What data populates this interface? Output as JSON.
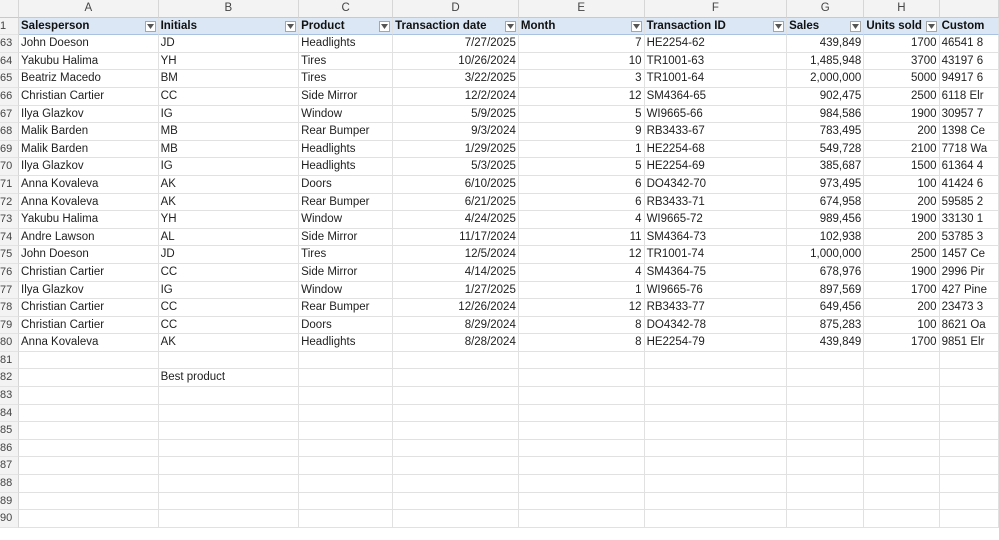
{
  "column_letters": [
    "A",
    "B",
    "C",
    "D",
    "E",
    "F",
    "G",
    "H",
    ""
  ],
  "header_row_number": "1",
  "headers": [
    "Salesperson",
    "Initials",
    "Product",
    "Transaction date",
    "Month",
    "Transaction ID",
    "Sales",
    "Units sold",
    "Custom"
  ],
  "rows": [
    {
      "n": "63",
      "cells": [
        "John Doeson",
        "JD",
        "Headlights",
        "7/27/2025",
        "7",
        "HE2254-62",
        "439,849",
        "1700",
        "46541 8"
      ]
    },
    {
      "n": "64",
      "cells": [
        "Yakubu Halima",
        "YH",
        "Tires",
        "10/26/2024",
        "10",
        "TR1001-63",
        "1,485,948",
        "3700",
        "43197 6"
      ]
    },
    {
      "n": "65",
      "cells": [
        "Beatriz Macedo",
        "BM",
        "Tires",
        "3/22/2025",
        "3",
        "TR1001-64",
        "2,000,000",
        "5000",
        "94917 6"
      ]
    },
    {
      "n": "66",
      "cells": [
        "Christian Cartier",
        "CC",
        "Side Mirror",
        "12/2/2024",
        "12",
        "SM4364-65",
        "902,475",
        "2500",
        "6118 Elr"
      ]
    },
    {
      "n": "67",
      "cells": [
        "Ilya Glazkov",
        "IG",
        "Window",
        "5/9/2025",
        "5",
        "WI9665-66",
        "984,586",
        "1900",
        "30957 7"
      ]
    },
    {
      "n": "68",
      "cells": [
        "Malik Barden",
        "MB",
        "Rear Bumper",
        "9/3/2024",
        "9",
        "RB3433-67",
        "783,495",
        "200",
        "1398 Ce"
      ]
    },
    {
      "n": "69",
      "cells": [
        "Malik Barden",
        "MB",
        "Headlights",
        "1/29/2025",
        "1",
        "HE2254-68",
        "549,728",
        "2100",
        "7718 Wa"
      ]
    },
    {
      "n": "70",
      "cells": [
        "Ilya Glazkov",
        "IG",
        "Headlights",
        "5/3/2025",
        "5",
        "HE2254-69",
        "385,687",
        "1500",
        "61364 4"
      ]
    },
    {
      "n": "71",
      "cells": [
        "Anna Kovaleva",
        "AK",
        "Doors",
        "6/10/2025",
        "6",
        "DO4342-70",
        "973,495",
        "100",
        "41424 6"
      ]
    },
    {
      "n": "72",
      "cells": [
        "Anna Kovaleva",
        "AK",
        "Rear Bumper",
        "6/21/2025",
        "6",
        "RB3433-71",
        "674,958",
        "200",
        "59585 2"
      ]
    },
    {
      "n": "73",
      "cells": [
        "Yakubu Halima",
        "YH",
        "Window",
        "4/24/2025",
        "4",
        "WI9665-72",
        "989,456",
        "1900",
        "33130 1"
      ]
    },
    {
      "n": "74",
      "cells": [
        "Andre Lawson",
        "AL",
        "Side Mirror",
        "11/17/2024",
        "11",
        "SM4364-73",
        "102,938",
        "200",
        "53785 3"
      ]
    },
    {
      "n": "75",
      "cells": [
        "John Doeson",
        "JD",
        "Tires",
        "12/5/2024",
        "12",
        "TR1001-74",
        "1,000,000",
        "2500",
        "1457 Ce"
      ]
    },
    {
      "n": "76",
      "cells": [
        "Christian Cartier",
        "CC",
        "Side Mirror",
        "4/14/2025",
        "4",
        "SM4364-75",
        "678,976",
        "1900",
        "2996 Pir"
      ]
    },
    {
      "n": "77",
      "cells": [
        "Ilya Glazkov",
        "IG",
        "Window",
        "1/27/2025",
        "1",
        "WI9665-76",
        "897,569",
        "1700",
        "427 Pine"
      ]
    },
    {
      "n": "78",
      "cells": [
        "Christian Cartier",
        "CC",
        "Rear Bumper",
        "12/26/2024",
        "12",
        "RB3433-77",
        "649,456",
        "200",
        "23473 3"
      ]
    },
    {
      "n": "79",
      "cells": [
        "Christian Cartier",
        "CC",
        "Doors",
        "8/29/2024",
        "8",
        "DO4342-78",
        "875,283",
        "100",
        "8621 Oa"
      ]
    },
    {
      "n": "80",
      "cells": [
        "Anna Kovaleva",
        "AK",
        "Headlights",
        "8/28/2024",
        "8",
        "HE2254-79",
        "439,849",
        "1700",
        "9851 Elr"
      ]
    },
    {
      "n": "81",
      "cells": [
        "",
        "",
        "",
        "",
        "",
        "",
        "",
        "",
        ""
      ]
    },
    {
      "n": "82",
      "cells": [
        "",
        "Best product",
        "",
        "",
        "",
        "",
        "",
        "",
        ""
      ]
    },
    {
      "n": "83",
      "cells": [
        "",
        "",
        "",
        "",
        "",
        "",
        "",
        "",
        ""
      ]
    },
    {
      "n": "84",
      "cells": [
        "",
        "",
        "",
        "",
        "",
        "",
        "",
        "",
        ""
      ]
    },
    {
      "n": "85",
      "cells": [
        "",
        "",
        "",
        "",
        "",
        "",
        "",
        "",
        ""
      ]
    },
    {
      "n": "86",
      "cells": [
        "",
        "",
        "",
        "",
        "",
        "",
        "",
        "",
        ""
      ]
    },
    {
      "n": "87",
      "cells": [
        "",
        "",
        "",
        "",
        "",
        "",
        "",
        "",
        ""
      ]
    },
    {
      "n": "88",
      "cells": [
        "",
        "",
        "",
        "",
        "",
        "",
        "",
        "",
        ""
      ]
    },
    {
      "n": "89",
      "cells": [
        "",
        "",
        "",
        "",
        "",
        "",
        "",
        "",
        ""
      ]
    },
    {
      "n": "90",
      "cells": [
        "",
        "",
        "",
        "",
        "",
        "",
        "",
        "",
        ""
      ]
    }
  ],
  "numeric_columns": [
    3,
    4,
    6,
    7
  ],
  "icons": {
    "filter": "filter-dropdown-icon"
  },
  "colors": {
    "table_header_bg": "#dbe7f5",
    "grid_line": "#e1e1e1",
    "header_strip_bg": "#f3f3f3"
  }
}
